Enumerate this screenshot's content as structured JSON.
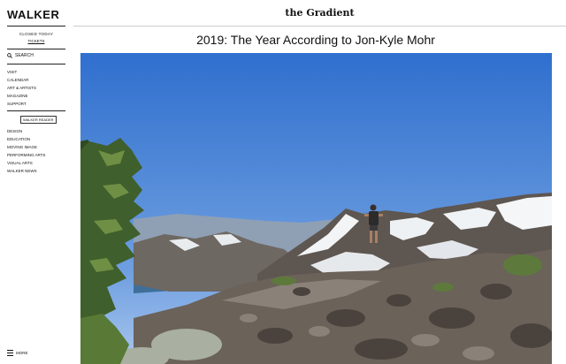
{
  "sidebar": {
    "logo": "WALKER",
    "status": "CLOSED TODAY",
    "tickets": "TICKETS",
    "search_label": "SEARCH",
    "nav_primary": [
      "VISIT",
      "CALENDAR",
      "ART & ARTISTS",
      "MAGAZINE",
      "SUPPORT"
    ],
    "reader_button": "WALKER READER",
    "nav_reader": [
      "DESIGN",
      "EDUCATION",
      "MOVING IMAGE",
      "PERFORMING ARTS",
      "VISUAL ARTS",
      "WALKER NEWS"
    ],
    "more_label": "MORE"
  },
  "header": {
    "brand": "the Gradient"
  },
  "article": {
    "title": "2019: The Year According to Jon-Kyle Mohr"
  }
}
